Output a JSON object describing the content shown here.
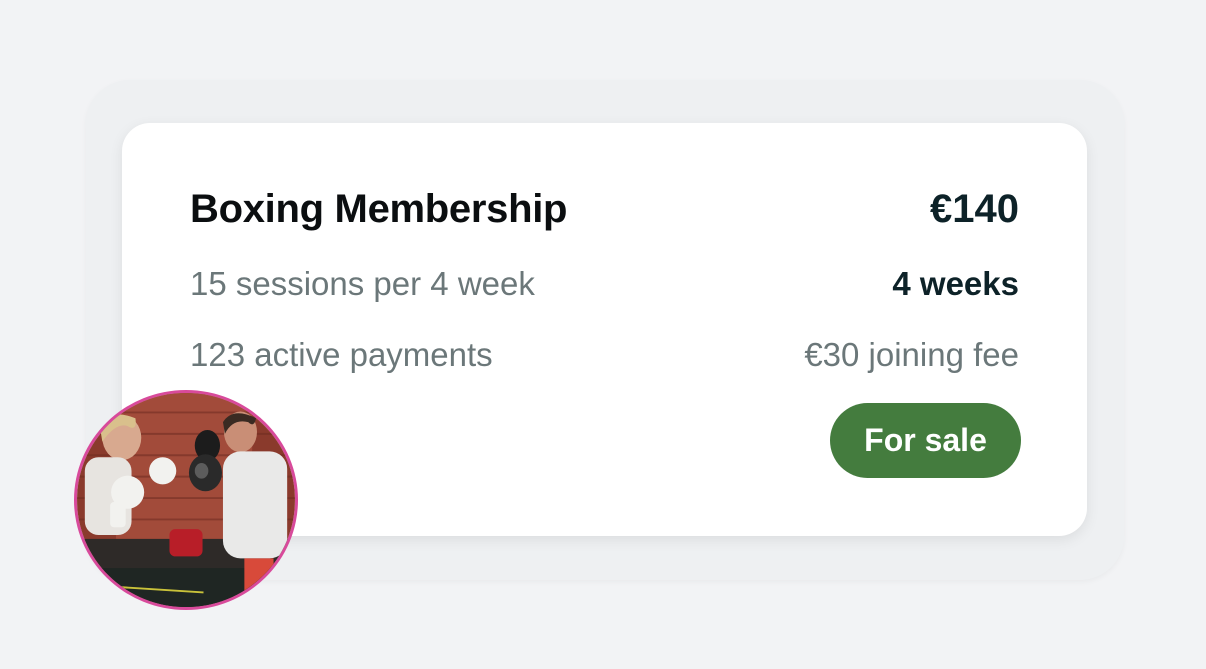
{
  "membership": {
    "title": "Boxing Membership",
    "price": "€140",
    "sessions": "15 sessions per 4 week",
    "duration": "4 weeks",
    "payments": "123 active payments",
    "joining_fee": "€30 joining fee",
    "status": "For sale"
  },
  "colors": {
    "background": "#f2f3f5",
    "card": "#ffffff",
    "status_badge": "#447c3e",
    "avatar_border": "#d84a9b",
    "muted_text": "#6b7779",
    "dark_text": "#0d2228"
  },
  "avatar": {
    "subject": "boxing-training-photo"
  }
}
